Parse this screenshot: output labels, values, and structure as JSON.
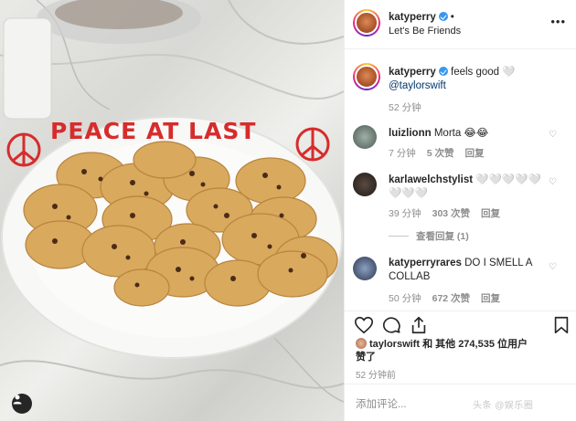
{
  "photo": {
    "plate_text": "PEACE AT LAST",
    "alt": ""
  },
  "header": {
    "username": "katyperry",
    "separator": "•",
    "location": "Let's Be Friends",
    "more_label": "•••"
  },
  "caption": {
    "username": "katyperry",
    "text": "feels good 🤍",
    "mention": "@taylorswift",
    "time": "52 分钟"
  },
  "comments": [
    {
      "username": "luizlionn",
      "text": "Morta 😂😂",
      "time": "7 分钟",
      "likes": "5 次赞",
      "reply": "回复"
    },
    {
      "username": "karlawelchstylist",
      "text": "🤍🤍🤍🤍🤍🤍🤍🤍",
      "time": "39 分钟",
      "likes": "303 次赞",
      "reply": "回复",
      "view_replies": "查看回复 (1)"
    },
    {
      "username": "katyperryrares",
      "text": "DO I SMELL A COLLAB",
      "time": "50 分钟",
      "likes": "672 次赞",
      "reply": "回复"
    }
  ],
  "likes": {
    "liker": "taylorswift",
    "rest": "和 其他 274,535 位用户",
    "suffix": "赞了"
  },
  "post_time": "52 分钟前",
  "add_comment_placeholder": "添加评论...",
  "watermark": "头条 @娱乐圈"
}
